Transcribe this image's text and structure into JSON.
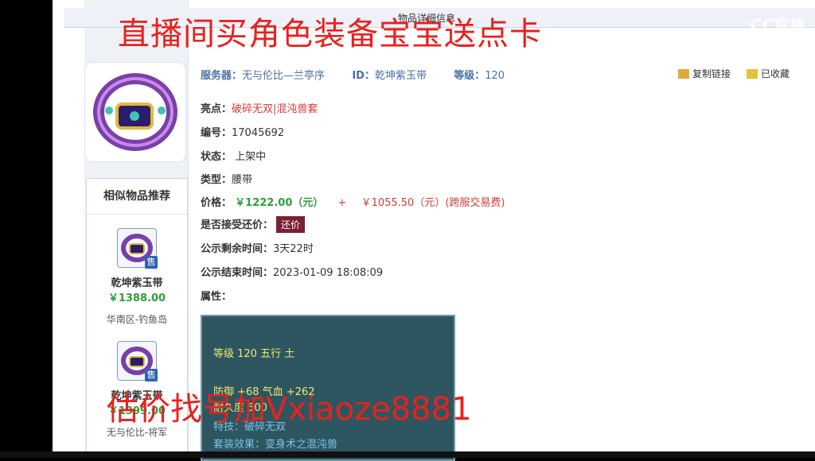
{
  "header": {
    "title": "物品详细信息"
  },
  "overlay": {
    "top_text": "直播间买角色装备宝宝送点卡",
    "bottom_text": "估价找号加Vxiaoze8881",
    "logo": "CC直播"
  },
  "item": {
    "server_label": "服务器：",
    "server": "无与伦比—兰亭序",
    "id_label": "ID：",
    "id": "乾坤紫玉带",
    "level_label": "等级：",
    "level": "120",
    "copy_link": "复制链接",
    "favorite": "已收藏",
    "highlight_label": "亮点：",
    "highlight": "破碎无双|混沌兽套",
    "number_label": "编号：",
    "number": "17045692",
    "status_label": "状态：",
    "status": "上架中",
    "type_label": "类型：",
    "type": "腰带",
    "price_label": "价格：",
    "price": "￥1222.00（元）",
    "plus": "+",
    "cross_fee": "￥1055.50（元）(跨服交易费)",
    "counter_label": "是否接受还价：",
    "counter_button": "还价",
    "remaining_label": "公示剩余时间：",
    "remaining": "3天22时",
    "end_label": "公示结束时间：",
    "end": "2023-01-09 18:08:09",
    "attr_label": "属性："
  },
  "attributes": [
    "等级 120 五行 土",
    "防御 +68 气血 +262",
    "耐久度 500",
    "特技：破碎无双",
    "套装效果：变身术之混沌兽"
  ],
  "similar": {
    "title": "相似物品推荐",
    "badge": "售",
    "items": [
      {
        "name": "乾坤紫玉带",
        "price": "￥1388.00",
        "server": "华南区-钓鱼岛"
      },
      {
        "name": "乾坤紫玉带",
        "price": "￥1399.00",
        "server": "无与伦比-将军"
      }
    ]
  },
  "colors": {
    "accent_red": "#e8211e",
    "label_blue": "#4a6fa5",
    "price_green": "#2d9f3a",
    "button_maroon": "#7a1f34"
  }
}
